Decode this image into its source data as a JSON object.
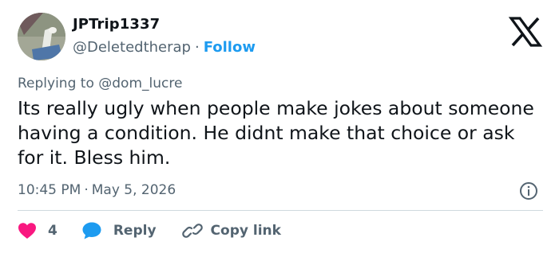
{
  "author": {
    "display_name": "JPTrip1337",
    "handle": "@Deletedtherap",
    "separator": "·",
    "follow_label": "Follow"
  },
  "reply_context": {
    "prefix": "Replying to",
    "mention": "@dom_lucre"
  },
  "tweet": {
    "text": "Its really ugly when people make jokes about someone having a condition. He didnt make that choice or ask for it. Bless him.",
    "time": "10:45 PM",
    "separator": "·",
    "date": "May 5, 2026"
  },
  "actions": {
    "like_count": "4",
    "reply_label": "Reply",
    "copy_link_label": "Copy link"
  },
  "icons": {
    "logo": "x-logo-icon",
    "info": "info-icon",
    "like": "heart-icon",
    "reply": "speech-bubble-icon",
    "copy": "link-icon"
  },
  "colors": {
    "text_primary": "#0f1419",
    "text_secondary": "#536471",
    "link_blue": "#1d9bf0",
    "heart_pink": "#f91880",
    "divider": "#cfd9de"
  }
}
